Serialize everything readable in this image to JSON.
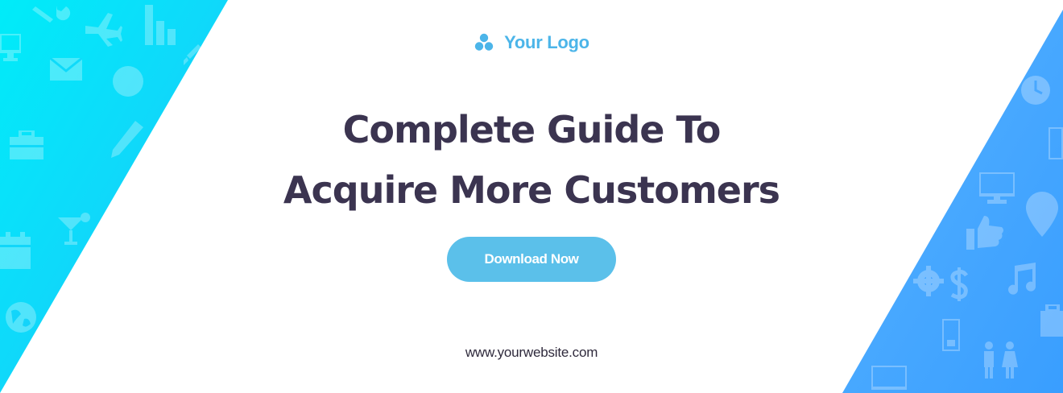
{
  "brand": {
    "logo_text": "Your Logo",
    "logo_icon": "three-circles-logo-icon",
    "logo_color": "#4cb5e9"
  },
  "headline": {
    "line1": "Complete Guide To",
    "line2": "Acquire More Customers",
    "color": "#3b3450"
  },
  "cta": {
    "label": "Download Now",
    "background": "#5bc0ea"
  },
  "footer": {
    "website": "www.yourwebsite.com"
  },
  "decor": {
    "left_panel_colors": [
      "#00e8f8",
      "#22c6fb"
    ],
    "right_panel_colors": [
      "#3aa0ff",
      "#5bb4ff"
    ],
    "left_icons": [
      "wrench-icon",
      "airplane-icon",
      "bar-chart-icon",
      "monitor-icon",
      "envelope-icon",
      "circle-icon",
      "briefcase-icon",
      "pencil-icon",
      "calendar-icon",
      "cocktail-icon",
      "globe-icon",
      "brush-icon"
    ],
    "right_icons": [
      "clock-icon",
      "phone-icon",
      "monitor-icon",
      "map-pin-icon",
      "thumbs-up-icon",
      "settings-gear-icon",
      "dollar-icon",
      "music-note-icon",
      "briefcase-icon",
      "phone-icon",
      "people-icon",
      "monitor-icon"
    ]
  }
}
